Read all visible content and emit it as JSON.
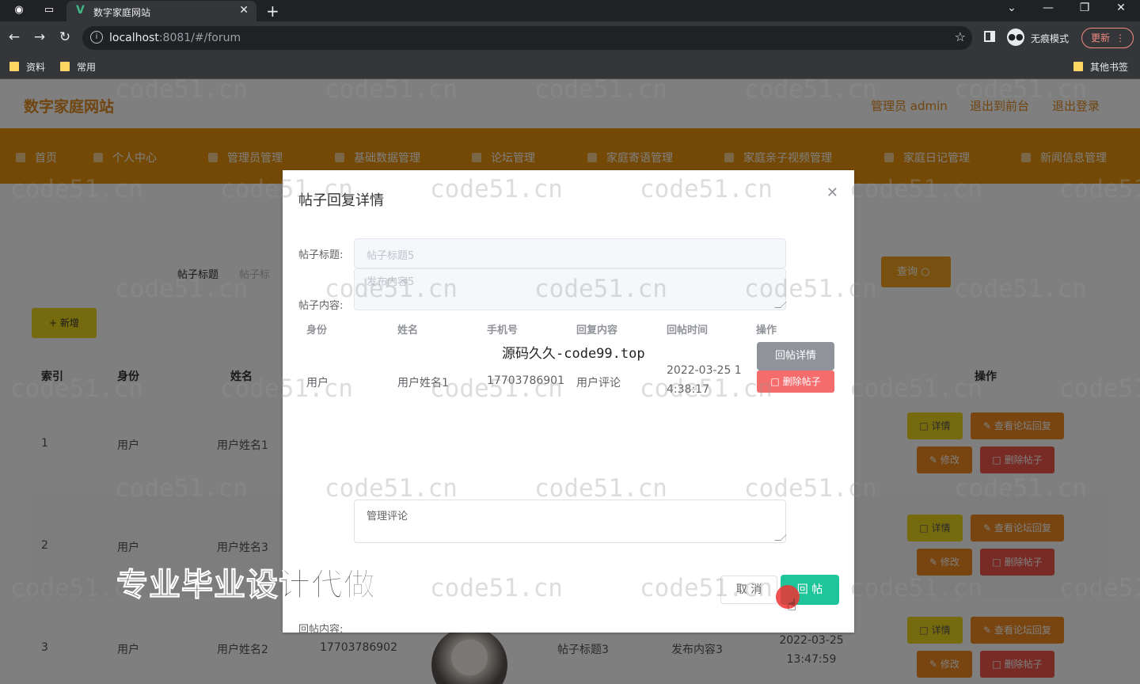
{
  "browser": {
    "tab_title": "数字家庭网站",
    "url_host": "localhost",
    "url_rest": ":8081/#/forum",
    "incognito_label": "无痕模式",
    "update_label": "更新",
    "bookmarks": [
      "资料",
      "常用"
    ],
    "other_bookmarks": "其他书签"
  },
  "site": {
    "logo": "数字家庭网站",
    "header_links": [
      "管理员 admin",
      "退出到前台",
      "退出登录"
    ],
    "menu": [
      "首页",
      "个人中心",
      "管理员管理",
      "基础数据管理",
      "论坛管理",
      "家庭寄语管理",
      "家庭亲子视频管理",
      "家庭日记管理",
      "新闻信息管理"
    ]
  },
  "list": {
    "search_label": "帖子标题",
    "search_placeholder": "帖子标",
    "query_label": "查询",
    "add_label": "新增",
    "columns": [
      "索引",
      "身份",
      "姓名",
      "操作"
    ],
    "rows": [
      {
        "index": "1",
        "role": "用户",
        "name": "用户姓名1"
      },
      {
        "index": "2",
        "role": "用户",
        "name": "用户姓名3"
      },
      {
        "index": "3",
        "role": "用户",
        "name": "用户姓名2",
        "phone": "17703786902",
        "title": "帖子标题3",
        "content": "发布内容3",
        "time": "2022-03-25 13:47:59"
      }
    ],
    "actions": {
      "detail": "详情",
      "replies": "查看论坛回复",
      "edit": "修改",
      "delete": "删除帖子"
    }
  },
  "dialog": {
    "title": "帖子回复详情",
    "title_label": "帖子标题:",
    "title_value": "帖子标题5",
    "content_label": "帖子内容:",
    "content_value": "发布内容5",
    "reply_columns": [
      "身份",
      "姓名",
      "手机号",
      "回复内容",
      "回帖时间",
      "操作"
    ],
    "replies": [
      {
        "role": "用户",
        "name": "用户姓名1",
        "phone": "17703786901",
        "content": "用户评论",
        "time_line1": "2022-03-25 1",
        "time_line2": "4:38:17"
      }
    ],
    "reply_detail_btn": "回帖详情",
    "reply_delete_btn": "删除帖子",
    "reply_label": "回帖内容:",
    "reply_value": "管理评论",
    "cancel_label": "取 消",
    "submit_label": "回 帖"
  },
  "watermarks": {
    "repeat_text": "code51.cn",
    "center_text": "源码久久-code99.top",
    "promo_text": "专业毕业设计代做"
  }
}
